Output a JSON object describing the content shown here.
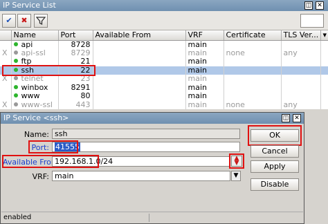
{
  "list_window": {
    "title": "IP Service List",
    "window_btns": [
      "◫",
      "✕"
    ],
    "columns": [
      "Name",
      "Port",
      "Available From",
      "VRF",
      "Certificate",
      "TLS Ver..."
    ],
    "rows": [
      {
        "flag": "",
        "enabled": true,
        "name": "api",
        "port": "8728",
        "from": "",
        "vrf": "main",
        "cert": "",
        "tls": ""
      },
      {
        "flag": "X",
        "enabled": false,
        "name": "api-ssl",
        "port": "8729",
        "from": "",
        "vrf": "main",
        "cert": "none",
        "tls": "any"
      },
      {
        "flag": "",
        "enabled": true,
        "name": "ftp",
        "port": "21",
        "from": "",
        "vrf": "main",
        "cert": "",
        "tls": ""
      },
      {
        "flag": "",
        "enabled": true,
        "name": "ssh",
        "port": "22",
        "from": "",
        "vrf": "main",
        "cert": "",
        "tls": "",
        "selected": true
      },
      {
        "flag": "X",
        "enabled": false,
        "name": "telnet",
        "port": "23",
        "from": "",
        "vrf": "main",
        "cert": "",
        "tls": ""
      },
      {
        "flag": "",
        "enabled": true,
        "name": "winbox",
        "port": "8291",
        "from": "",
        "vrf": "main",
        "cert": "",
        "tls": ""
      },
      {
        "flag": "",
        "enabled": true,
        "name": "www",
        "port": "80",
        "from": "",
        "vrf": "main",
        "cert": "",
        "tls": ""
      },
      {
        "flag": "X",
        "enabled": false,
        "name": "www-ssl",
        "port": "443",
        "from": "",
        "vrf": "main",
        "cert": "none",
        "tls": "any"
      }
    ]
  },
  "dialog": {
    "title": "IP Service <ssh>",
    "window_btns": [
      "◫",
      "✕"
    ],
    "name_label": "Name:",
    "name_value": "ssh",
    "port_label": "Port:",
    "port_value": "41555",
    "from_label": "Available From:",
    "from_value": "192.168.1.0/24",
    "vrf_label": "VRF:",
    "vrf_value": "main",
    "ok": "OK",
    "cancel": "Cancel",
    "apply": "Apply",
    "disable": "Disable",
    "status": "enabled"
  },
  "colors": {
    "highlight_red": "#e01010",
    "selected_row": "#b0c8e8",
    "enabled_dot": "#2db52d"
  }
}
